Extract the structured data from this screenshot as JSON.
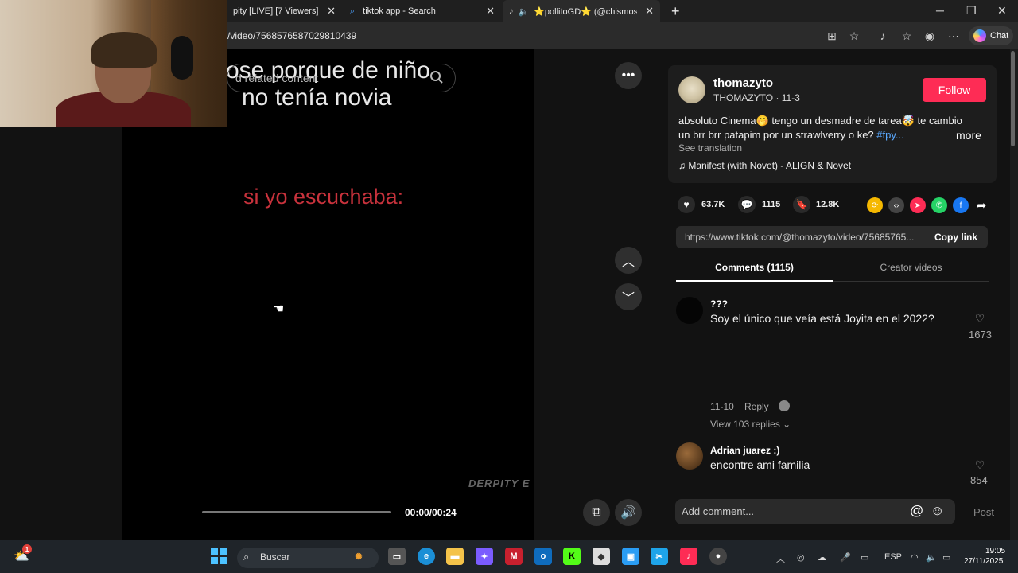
{
  "browser": {
    "tabs": [
      {
        "label": "pity [LIVE] [7 Viewers]"
      },
      {
        "label": "tiktok app - Search"
      },
      {
        "label": "⭐pollitoGD⭐ (@chismoso"
      }
    ],
    "url": "/video/7568576587029810439",
    "chat_label": "Chat"
  },
  "video": {
    "overlay_line1": "ose porque de niño",
    "overlay_line2": "no tenía novia",
    "overlay_red": "si yo escuchaba:",
    "related_search_placeholder": "d related content",
    "watermark": "DERPITY E",
    "timecode": "00:00/00:24",
    "progress": 0.0
  },
  "post": {
    "username": "thomazyto",
    "display_name": "THOMAZYTO · 11-3",
    "follow_label": "Follow",
    "desc_line1": "absoluto Cinema🤭 tengo un desmadre de tarea🤯 te cambio",
    "desc_line2": "un brr brr patapim por un strawlverry o ke?",
    "hashtag": "#fpy...",
    "more_label": "more",
    "see_translation": "See translation",
    "music": "♫  Manifest (with Novet) - ALIGN & Novet",
    "likes": "63.7K",
    "comments_count": "1115",
    "saves": "12.8K",
    "link": "https://www.tiktok.com/@thomazyto/video/75685765...",
    "copy_link_label": "Copy link",
    "tab_comments": "Comments (1115)",
    "tab_creator": "Creator videos"
  },
  "comments": [
    {
      "name": "???",
      "text": "Soy el único que veía está Joyita en el 2022?",
      "likes": "1673",
      "date": "11-10",
      "reply_label": "Reply",
      "view_replies": "View 103 replies ⌄"
    },
    {
      "name": "Adrian juarez :)",
      "text": "encontre ami familia",
      "likes": "854"
    }
  ],
  "comment_input": {
    "placeholder": "Add comment...",
    "post_label": "Post"
  },
  "taskbar": {
    "search_label": "Buscar",
    "lang": "ESP",
    "time": "19:05",
    "date": "27/11/2025",
    "notification_badge": "1"
  },
  "colors": {
    "accent_follow": "#fe2c55",
    "hashtag": "#5aa9ff",
    "video_red_text": "#c8323c"
  }
}
